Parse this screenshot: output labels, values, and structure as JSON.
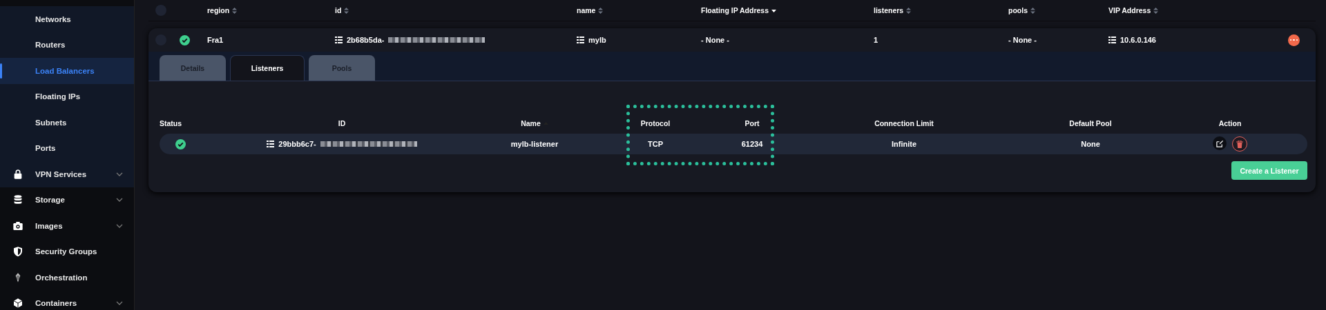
{
  "sidebar": {
    "items": [
      {
        "label": "Networks",
        "selected": false
      },
      {
        "label": "Routers",
        "selected": false
      },
      {
        "label": "Load Balancers",
        "selected": true
      },
      {
        "label": "Floating IPs",
        "selected": false
      },
      {
        "label": "Subnets",
        "selected": false
      },
      {
        "label": "Ports",
        "selected": false
      },
      {
        "label": "VPN Services",
        "selected": false,
        "expanded": false
      },
      {
        "label": "Storage",
        "selected": false,
        "expanded": false
      },
      {
        "label": "Images",
        "selected": false,
        "expanded": false
      },
      {
        "label": "Security Groups",
        "selected": false
      },
      {
        "label": "Orchestration",
        "selected": false
      },
      {
        "label": "Containers",
        "selected": false,
        "expanded": false
      }
    ]
  },
  "table": {
    "select_all_checked": false,
    "columns": [
      {
        "label": "region",
        "kind": "sortable"
      },
      {
        "label": "id",
        "kind": "sortable"
      },
      {
        "label": "name",
        "kind": "sortable"
      },
      {
        "label": "Floating IP Address",
        "kind": "sorted"
      },
      {
        "label": "listeners",
        "kind": "sortable"
      },
      {
        "label": "pools",
        "kind": "sortable"
      },
      {
        "label": "VIP Address",
        "kind": "sortable"
      }
    ],
    "rows": [
      {
        "checked": false,
        "healthy": true,
        "region": "Fra1",
        "id": "2b68b5da-",
        "name": "mylb",
        "floating_ip": "- None -",
        "listeners": "1",
        "pools": "- None -",
        "vip": "10.6.0.146",
        "expanded": true
      }
    ]
  },
  "details": {
    "tabs": [
      {
        "label": "Details",
        "selected": false
      },
      {
        "label": "Listeners",
        "selected": true
      },
      {
        "label": "Pools",
        "selected": false
      }
    ],
    "columns": [
      {
        "label": "Status",
        "kind": "plain"
      },
      {
        "label": "ID",
        "kind": "plain"
      },
      {
        "label": "Name",
        "kind": "sorted"
      },
      {
        "label": "Protocol",
        "kind": "plain"
      },
      {
        "label": "Port",
        "kind": "plain"
      },
      {
        "label": "Connection Limit",
        "kind": "plain"
      },
      {
        "label": "Default Pool",
        "kind": "plain"
      },
      {
        "label": "Action",
        "kind": "plain"
      }
    ],
    "rows": [
      {
        "healthy": true,
        "id": "29bbb6c7-",
        "name": "mylb-listener",
        "protocol": "TCP",
        "port": "61234",
        "connection_limit": "Infinite",
        "default_pool": "None"
      }
    ],
    "create_button": "Create a Listener"
  }
}
